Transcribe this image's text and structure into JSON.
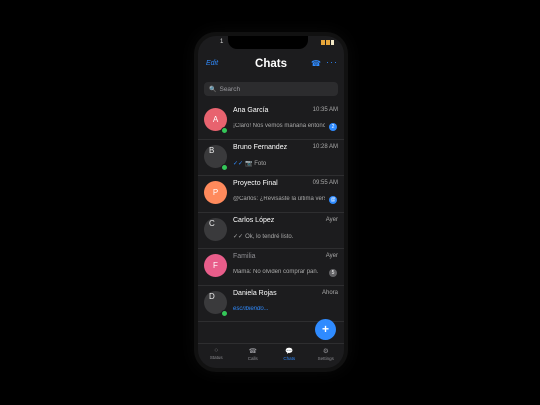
{
  "status_bar": {
    "time": "1"
  },
  "header": {
    "edit_label": "Edit",
    "title": "Chats"
  },
  "search": {
    "placeholder": "Search"
  },
  "chats": [
    {
      "initial": "A",
      "avatar_color": "#e8636f",
      "name": "Ana García",
      "time": "10:35 AM",
      "preview": "¡Claro! Nos vemos mañana entonces",
      "badge": "2",
      "online": true
    },
    {
      "initial": "B",
      "name": "Bruno Fernandez",
      "time": "10:28 AM",
      "preview_prefix": "✓✓",
      "preview": "📷 Foto",
      "online": true
    },
    {
      "initial": "P",
      "avatar_color": "#ff8a5c",
      "name": "Proyecto Final",
      "time": "09:55 AM",
      "preview": "@Carlos: ¿Revisaste la última versión?",
      "badge": "@"
    },
    {
      "initial": "C",
      "name": "Carlos López",
      "time": "Ayer",
      "preview_prefix": "✓✓",
      "preview": "Ok, lo tendré listo."
    },
    {
      "initial": "F",
      "avatar_color": "#e85d8a",
      "name": "Familia",
      "time": "Ayer",
      "preview": "Mamá: No olviden comprar pan.",
      "badge": "5",
      "muted": true
    },
    {
      "initial": "D",
      "name": "Daniela Rojas",
      "time": "Ahora",
      "preview": "escribiendo...",
      "typing": true,
      "online": true
    }
  ],
  "fab": {
    "label": "+"
  },
  "tabs": [
    {
      "icon": "○",
      "label": "Status"
    },
    {
      "icon": "☎",
      "label": "Calls"
    },
    {
      "icon": "💬",
      "label": "Chats",
      "active": true
    },
    {
      "icon": "⚙",
      "label": "Settings"
    }
  ]
}
